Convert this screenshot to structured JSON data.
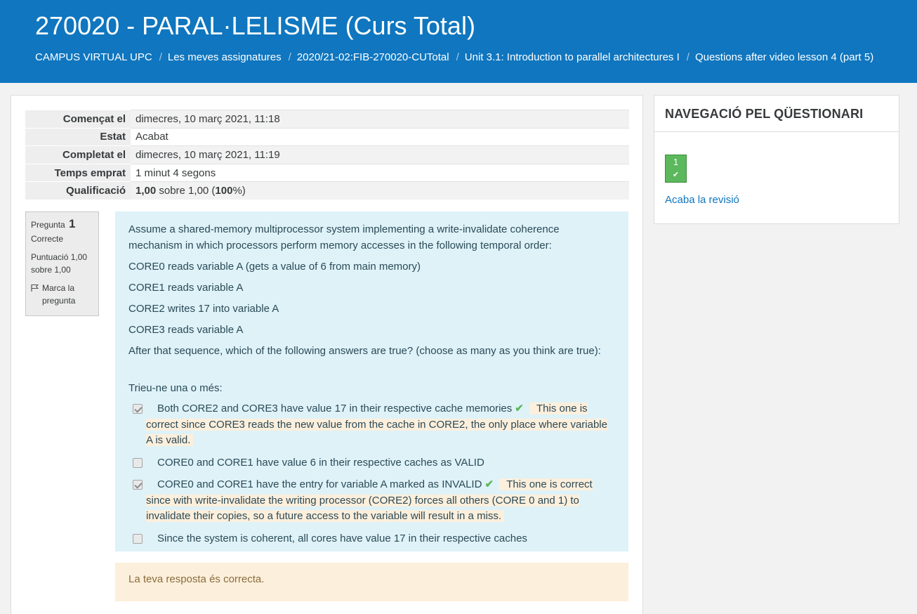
{
  "header": {
    "title": "270020 - PARAL·LELISME (Curs Total)",
    "breadcrumb": [
      "CAMPUS VIRTUAL UPC",
      "Les meves assignatures",
      "2020/21-02:FIB-270020-CUTotal",
      "Unit 3.1: Introduction to parallel architectures I",
      "Questions after video lesson 4 (part 5)"
    ]
  },
  "summary": {
    "rows": [
      {
        "label": "Començat el",
        "value": "dimecres, 10 març 2021, 11:18"
      },
      {
        "label": "Estat",
        "value": "Acabat"
      },
      {
        "label": "Completat el",
        "value": "dimecres, 10 març 2021, 11:19"
      },
      {
        "label": "Temps emprat",
        "value": "1 minut 4 segons"
      },
      {
        "label": "Qualificació",
        "grade": "1,00",
        "of": " sobre 1,00 (",
        "percent": "100",
        "suffix": "%)"
      }
    ]
  },
  "question_info": {
    "label": "Pregunta",
    "number": "1",
    "state": "Correcte",
    "score": "Puntuació 1,00 sobre 1,00",
    "flag": "Marca la pregunta"
  },
  "question": {
    "intro": "Assume a shared-memory multiprocessor system implementing a write-invalidate coherence mechanism in which processors perform memory accesses in the following temporal order:",
    "steps": [
      "CORE0 reads variable A (gets a value of 6 from main memory)",
      "CORE1 reads variable A",
      "CORE2 writes 17 into variable A",
      "CORE3 reads variable A"
    ],
    "question_text": "After that sequence, which of the following answers are true? (choose as many as you think are true):",
    "prompt": "Trieu-ne una o més:",
    "answers": [
      {
        "text": "Both CORE2 and CORE3 have value 17 in their respective cache memories",
        "checked": true,
        "correct": true,
        "feedback": "This one is correct since CORE3 reads the new value from the cache in CORE2, the only place where variable A is valid."
      },
      {
        "text": "CORE0 and CORE1 have value 6 in their respective caches as VALID",
        "checked": false,
        "correct": false,
        "feedback": ""
      },
      {
        "text": "CORE0 and CORE1 have the entry for variable A marked as INVALID",
        "checked": true,
        "correct": true,
        "feedback": "This one is correct since with write-invalidate the writing processor (CORE2) forces all others (CORE 0 and 1) to invalidate their copies, so a future access to the variable will result in a miss."
      },
      {
        "text": "Since the system is coherent, all cores have value 17 in their respective caches",
        "checked": false,
        "correct": false,
        "feedback": ""
      }
    ]
  },
  "outcome": "La teva resposta és correcta.",
  "navigation": {
    "title": "NAVEGACIÓ PEL QÜESTIONARI",
    "question_button": "1",
    "finish_link": "Acaba la revisió"
  },
  "colors": {
    "header_bg": "#0f76bf",
    "correct_green": "#5cb85c",
    "feedback_bg": "#fcefdc",
    "question_bg": "#def2f8"
  }
}
